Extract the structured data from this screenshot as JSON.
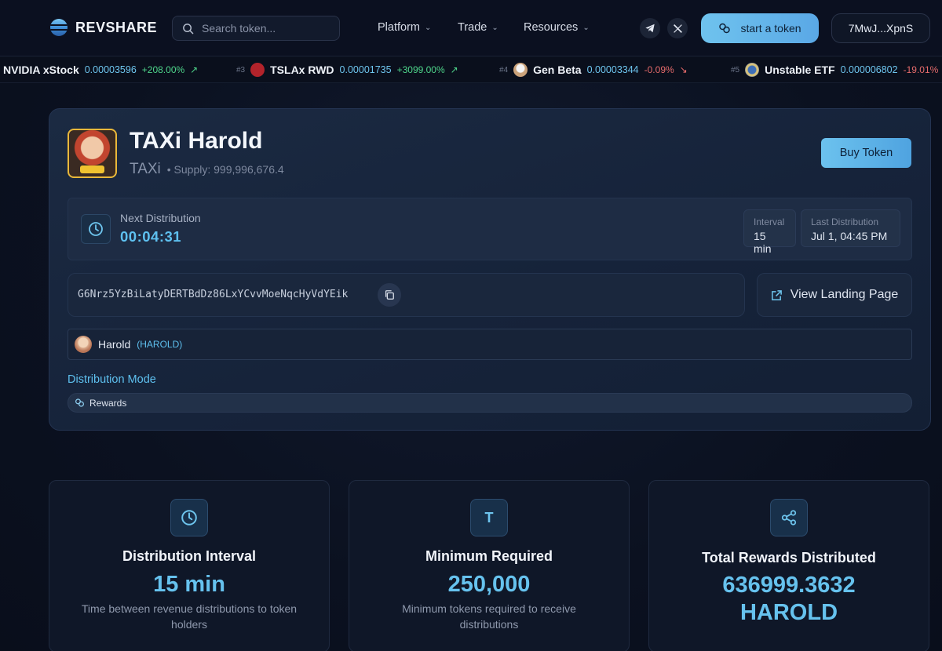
{
  "header": {
    "logo_text": "REVSHARE",
    "search_placeholder": "Search token...",
    "nav": [
      {
        "label": "Platform"
      },
      {
        "label": "Trade"
      },
      {
        "label": "Resources"
      }
    ],
    "start_button": "start a token",
    "wallet": "7MwJ...XpnS"
  },
  "ticker": [
    {
      "rank": "",
      "name": "NVIDIA xStock",
      "price": "0.00003596",
      "change": "+208.00%",
      "direction": "up"
    },
    {
      "rank": "#3",
      "name": "TSLAx RWD",
      "price": "0.00001735",
      "change": "+3099.00%",
      "direction": "up"
    },
    {
      "rank": "#4",
      "name": "Gen Beta",
      "price": "0.00003344",
      "change": "-0.09%",
      "direction": "down"
    },
    {
      "rank": "#5",
      "name": "Unstable ETF",
      "price": "0.000006802",
      "change": "-19.01%",
      "direction": "down"
    }
  ],
  "token": {
    "name": "TAXi Harold",
    "symbol": "TAXi",
    "supply": "• Supply: 999,996,676.4",
    "buy_button": "Buy Token"
  },
  "distribution": {
    "next_label": "Next Distribution",
    "next_value": "00:04:31",
    "interval_label": "Interval",
    "interval_value": "15 min",
    "last_label": "Last Distribution",
    "last_value": "Jul 1, 04:45 PM"
  },
  "contract": {
    "address": "G6Nrz5YzBiLatyDERTBdDz86LxYCvvMoeNqcHyVdYEik",
    "landing_button": "View Landing Page"
  },
  "creator": {
    "name": "Harold",
    "symbol": "(HAROLD)"
  },
  "mode": {
    "label": "Distribution Mode",
    "value": "Rewards"
  },
  "stats": [
    {
      "icon": "clock-icon",
      "title": "Distribution Interval",
      "value": "15 min",
      "desc": "Time between revenue distributions to token holders"
    },
    {
      "icon": "T",
      "title": "Minimum Required",
      "value": "250,000",
      "desc": "Minimum tokens required to receive distributions"
    },
    {
      "icon": "share-icon",
      "title": "Total Rewards Distributed",
      "value": "636999.3632",
      "value2": "HAROLD",
      "desc": ""
    }
  ],
  "colors": {
    "accent": "#5ec0ef",
    "up": "#4fd68b",
    "down": "#e56b6b",
    "background": "#0b1120"
  }
}
